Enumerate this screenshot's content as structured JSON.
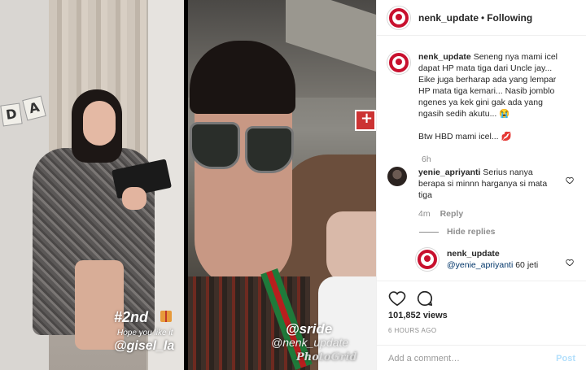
{
  "media": {
    "left_panel": {
      "banner_letters": [
        "D",
        "A"
      ],
      "story_tag": "#2nd",
      "story_sub": "Hope you like it",
      "story_handle": "@gisel_la"
    },
    "right_panel": {
      "watermark_1": "@sride",
      "watermark_2": "@nenk_update",
      "watermark_3": "PhotoGrid"
    }
  },
  "header": {
    "username": "nenk_update",
    "separator": "•",
    "follow_state": "Following"
  },
  "caption": {
    "username": "nenk_update",
    "text": "Seneng nya mami icel dapat HP mata tiga dari Uncle jay... Eike juga berharap ada yang lempar HP mata tiga kemari... Nasib jomblo ngenes ya kek gini gak ada yang ngasih sedih akutu... 😭",
    "text2": "Btw HBD mami icel... 💋",
    "time": "6h"
  },
  "comments": [
    {
      "username": "yenie_apriyanti",
      "text": "Serius nanya berapa si minnn harganya si mata tiga",
      "time": "4m",
      "reply_label": "Reply"
    }
  ],
  "hide_replies": "Hide replies",
  "reply": {
    "username": "nenk_update",
    "mention": "@yenie_apriyanti",
    "text": "60 jeti"
  },
  "actions": {
    "views": "101,852 views",
    "timeago": "6 HOURS AGO",
    "add_comment_placeholder": "Add a comment…",
    "post_label": "Post"
  },
  "icons": [
    "heart-icon",
    "comment-icon",
    "gift-icon",
    "shield-sign-icon"
  ],
  "colors": {
    "accent_red": "#c8102e",
    "link_blue": "#003569",
    "post_disabled": "#b2dffc",
    "muted_text": "#8e8e8e"
  }
}
